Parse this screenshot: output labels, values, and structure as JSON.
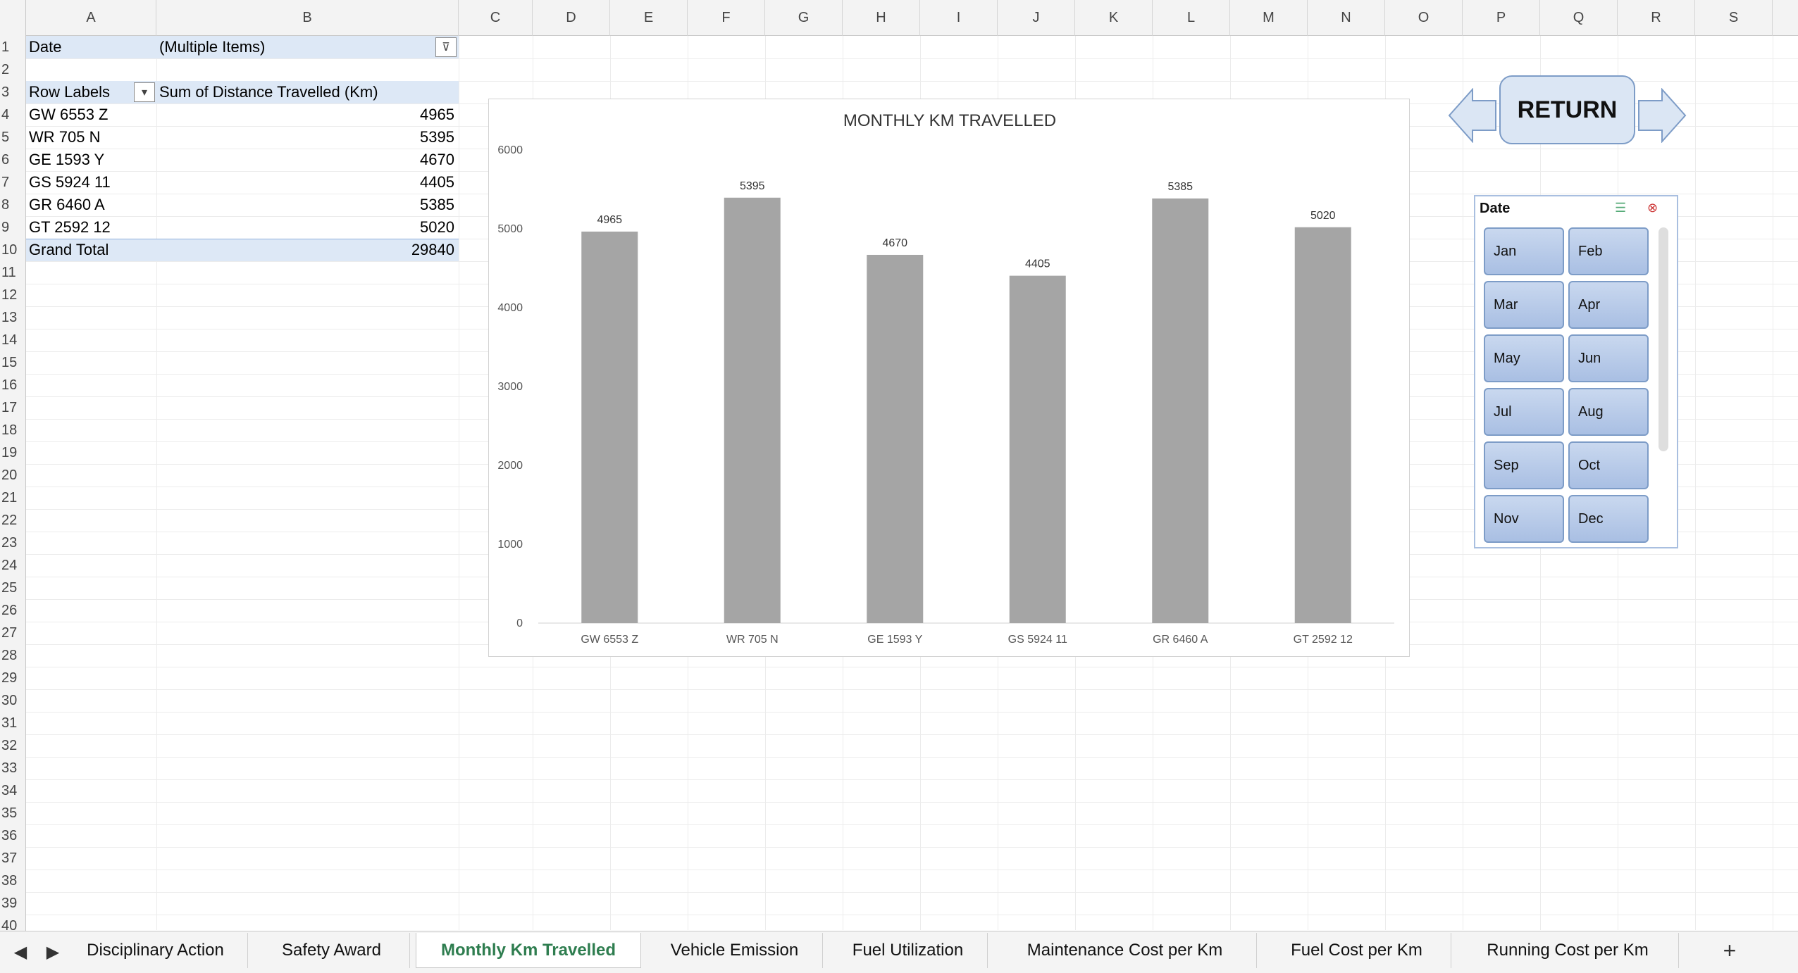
{
  "columns": [
    "A",
    "B",
    "C",
    "D",
    "E",
    "F",
    "G",
    "H",
    "I",
    "J",
    "K",
    "L",
    "M",
    "N",
    "O",
    "P",
    "Q",
    "R",
    "S"
  ],
  "rows": [
    "1",
    "2",
    "3",
    "4",
    "5",
    "6",
    "7",
    "8",
    "9",
    "10",
    "11",
    "12",
    "13",
    "14",
    "15",
    "16",
    "17",
    "18",
    "19",
    "20",
    "21",
    "22",
    "23",
    "24",
    "25",
    "26",
    "27",
    "28",
    "29",
    "30",
    "31",
    "32",
    "33",
    "34",
    "35",
    "36",
    "37",
    "38",
    "39",
    "40"
  ],
  "pivot": {
    "filter_label": "Date",
    "filter_value": "(Multiple Items)",
    "row_labels_header": "Row Labels",
    "value_header": "Sum of Distance Travelled (Km)",
    "items": [
      {
        "label": "GW 6553 Z",
        "value": "4965"
      },
      {
        "label": "WR 705 N",
        "value": "5395"
      },
      {
        "label": "GE 1593 Y",
        "value": "4670"
      },
      {
        "label": "GS 5924 11",
        "value": "4405"
      },
      {
        "label": "GR 6460 A",
        "value": "5385"
      },
      {
        "label": "GT 2592 12",
        "value": "5020"
      }
    ],
    "grand_total_label": "Grand Total",
    "grand_total_value": "29840"
  },
  "chart_data": {
    "type": "bar",
    "title": "MONTHLY KM TRAVELLED",
    "categories": [
      "GW 6553 Z",
      "WR 705 N",
      "GE 1593 Y",
      "GS 5924 11",
      "GR 6460 A",
      "GT 2592 12"
    ],
    "values": [
      4965,
      5395,
      4670,
      4405,
      5385,
      5020
    ],
    "yticks": [
      "0",
      "1000",
      "2000",
      "3000",
      "4000",
      "5000",
      "6000"
    ],
    "ylim": [
      0,
      6000
    ],
    "bar_color": "#a5a5a5",
    "grid": false,
    "legend": "none"
  },
  "return_button": {
    "label": "RETURN"
  },
  "slicer": {
    "title": "Date",
    "months": [
      "Jan",
      "Feb",
      "Mar",
      "Apr",
      "May",
      "Jun",
      "Jul",
      "Aug",
      "Sep",
      "Oct",
      "Nov",
      "Dec"
    ]
  },
  "tabs": {
    "items": [
      "Disciplinary Action",
      "Safety Award",
      "Monthly Km Travelled",
      "Vehicle Emission",
      "Fuel Utilization",
      "Maintenance Cost per Km",
      "Fuel Cost per Km",
      "Running Cost per Km"
    ],
    "active": "Monthly Km Travelled",
    "add_label": "+"
  },
  "colors": {
    "accent": "#2e7d4f",
    "pivot_band": "#dde8f6",
    "slicer_button": "#b9cbea"
  }
}
